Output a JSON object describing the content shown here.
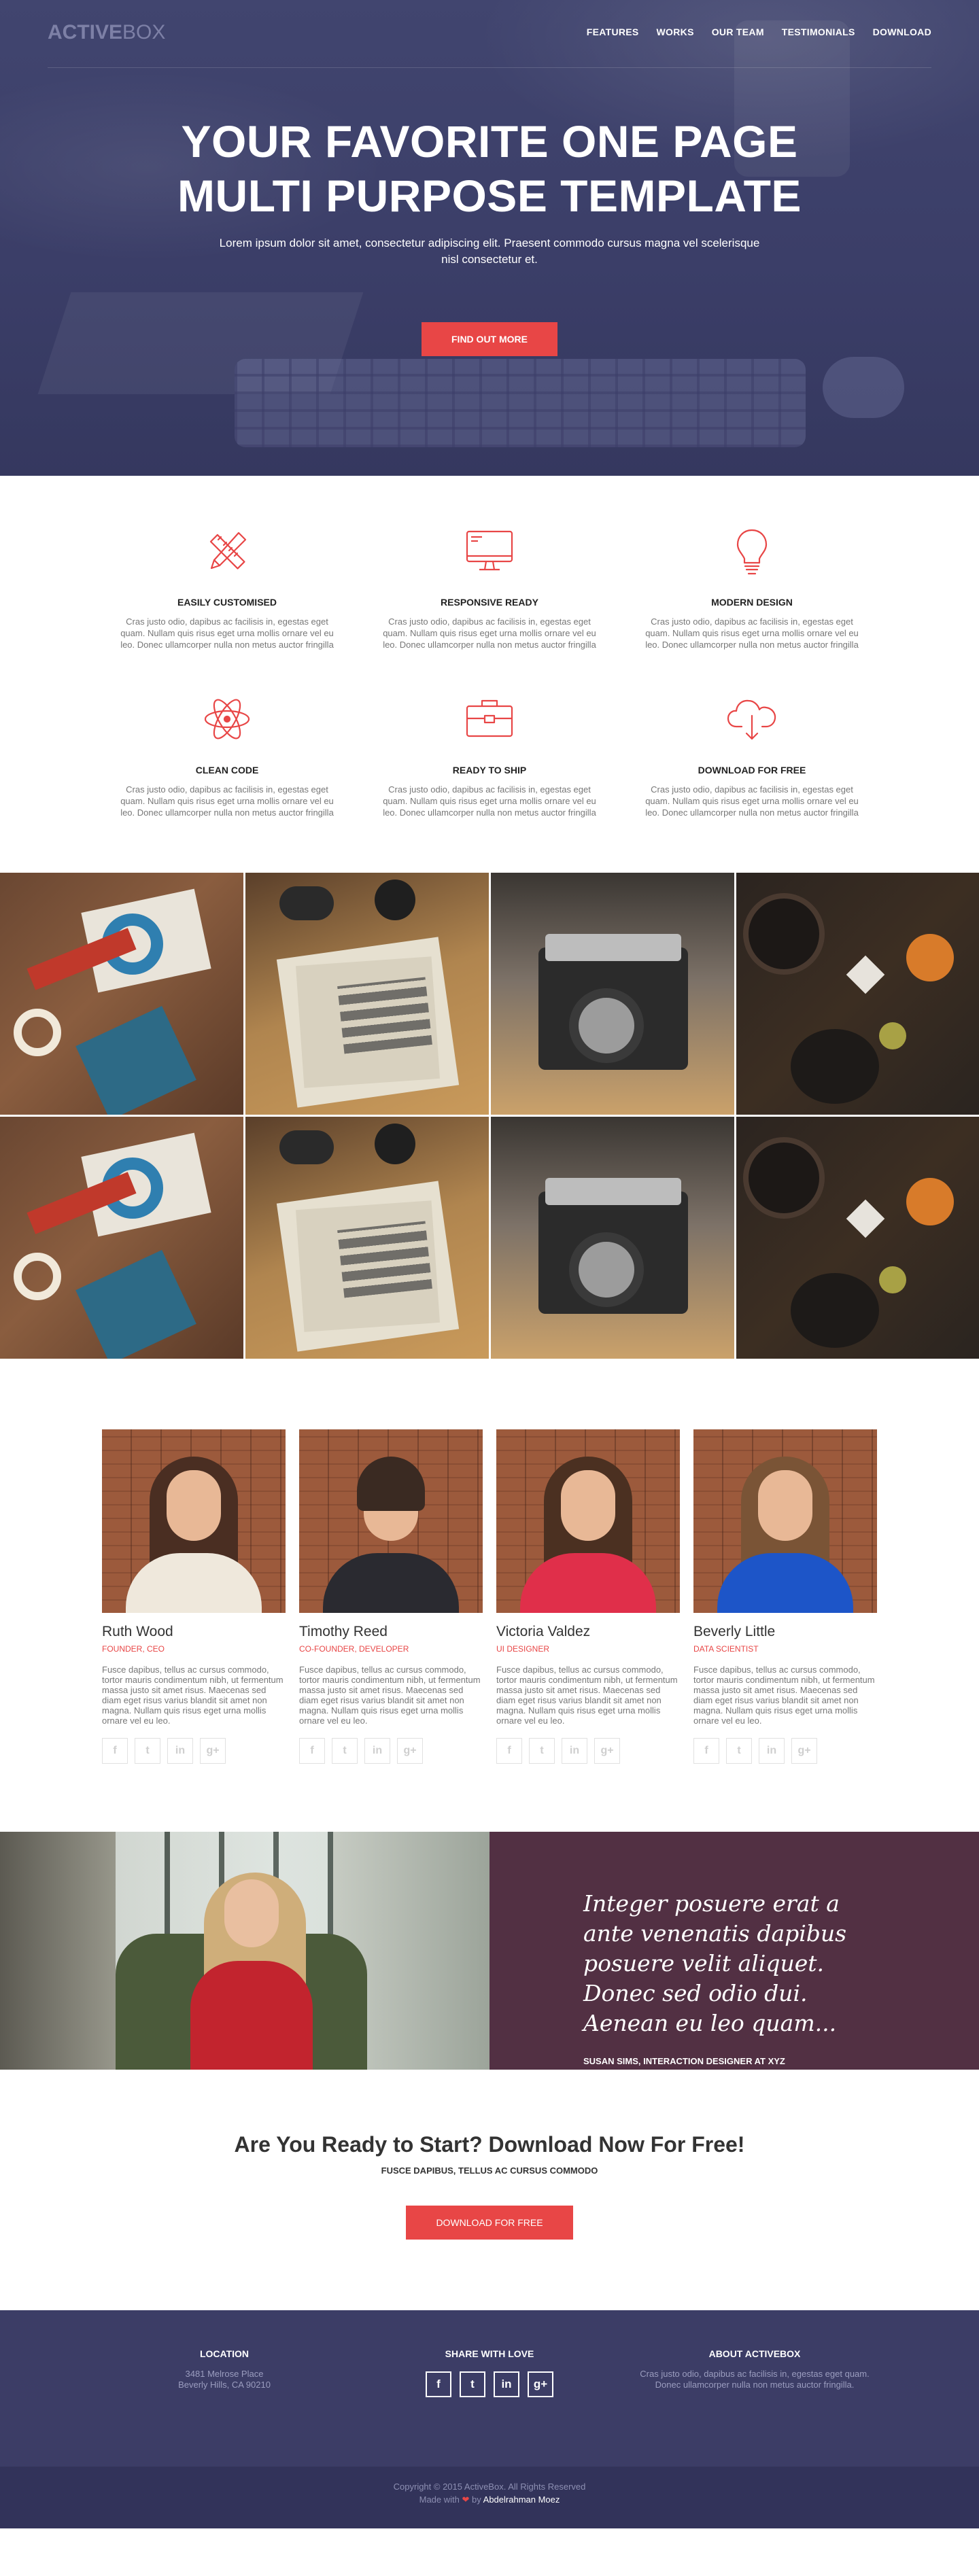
{
  "brand": {
    "part1": "ACTIVE",
    "part2": "BOX"
  },
  "nav": {
    "items": [
      "FEATURES",
      "WORKS",
      "OUR TEAM",
      "TESTIMONIALS",
      "DOWNLOAD"
    ]
  },
  "hero": {
    "title_line1": "YOUR FAVORITE ONE PAGE",
    "title_line2": "MULTI PURPOSE TEMPLATE",
    "subtitle": "Lorem ipsum dolor sit amet, consectetur adipiscing elit. Praesent commodo cursus magna vel scelerisque nisl consectetur et.",
    "button": "FIND OUT MORE"
  },
  "features": [
    {
      "icon": "pencil-ruler-icon",
      "title": "EASILY CUSTOMISED",
      "text": "Cras justo odio, dapibus ac facilisis in, egestas eget quam. Nullam quis risus eget urna mollis ornare vel eu leo. Donec ullamcorper nulla non metus auctor fringilla"
    },
    {
      "icon": "monitor-icon",
      "title": "RESPONSIVE READY",
      "text": "Cras justo odio, dapibus ac facilisis in, egestas eget quam. Nullam quis risus eget urna mollis ornare vel eu leo. Donec ullamcorper nulla non metus auctor fringilla"
    },
    {
      "icon": "lightbulb-icon",
      "title": "MODERN DESIGN",
      "text": "Cras justo odio, dapibus ac facilisis in, egestas eget quam. Nullam quis risus eget urna mollis ornare vel eu leo. Donec ullamcorper nulla non metus auctor fringilla"
    },
    {
      "icon": "atom-icon",
      "title": "CLEAN CODE",
      "text": "Cras justo odio, dapibus ac facilisis in, egestas eget quam. Nullam quis risus eget urna mollis ornare vel eu leo. Donec ullamcorper nulla non metus auctor fringilla"
    },
    {
      "icon": "briefcase-icon",
      "title": "READY TO SHIP",
      "text": "Cras justo odio, dapibus ac facilisis in, egestas eget quam. Nullam quis risus eget urna mollis ornare vel eu leo. Donec ullamcorper nulla non metus auctor fringilla"
    },
    {
      "icon": "cloud-download-icon",
      "title": "DOWNLOAD FOR FREE",
      "text": "Cras justo odio, dapibus ac facilisis in, egestas eget quam. Nullam quis risus eget urna mollis ornare vel eu leo. Donec ullamcorper nulla non metus auctor fringilla"
    }
  ],
  "team": [
    {
      "name": "Ruth Wood",
      "role": "FOUNDER, CEO",
      "bio": "Fusce dapibus, tellus ac cursus commodo, tortor mauris condimentum nibh, ut fermentum massa justo sit amet risus. Maecenas sed diam eget risus varius blandit sit amet non magna. Nullam quis risus eget urna mollis ornare vel eu leo."
    },
    {
      "name": "Timothy Reed",
      "role": "CO-FOUNDER, DEVELOPER",
      "bio": "Fusce dapibus, tellus ac cursus commodo, tortor mauris condimentum nibh, ut fermentum massa justo sit amet risus. Maecenas sed diam eget risus varius blandit sit amet non magna. Nullam quis risus eget urna mollis ornare vel eu leo."
    },
    {
      "name": "Victoria Valdez",
      "role": "UI DESIGNER",
      "bio": "Fusce dapibus, tellus ac cursus commodo, tortor mauris condimentum nibh, ut fermentum massa justo sit amet risus. Maecenas sed diam eget risus varius blandit sit amet non magna. Nullam quis risus eget urna mollis ornare vel eu leo."
    },
    {
      "name": "Beverly Little",
      "role": "DATA SCIENTIST",
      "bio": "Fusce dapibus, tellus ac cursus commodo, tortor mauris condimentum nibh, ut fermentum massa justo sit amet risus. Maecenas sed diam eget risus varius blandit sit amet non magna. Nullam quis risus eget urna mollis ornare vel eu leo."
    }
  ],
  "social_glyphs": {
    "facebook": "f",
    "twitter": "t",
    "linkedin": "in",
    "google": "g+"
  },
  "testimonial": {
    "quote": "Integer posuere erat a ante venenatis dapibus posuere velit aliquet. Donec sed odio dui. Aenean eu leo quam...",
    "author": "SUSAN SIMS, INTERACTION DESIGNER AT XYZ"
  },
  "cta": {
    "title": "Are You Ready to Start? Download Now For Free!",
    "subtitle": "FUSCE DAPIBUS, TELLUS AC CURSUS COMMODO",
    "button": "DOWNLOAD FOR FREE"
  },
  "footer": {
    "location_title": "LOCATION",
    "address_line1": "3481 Melrose Place",
    "address_line2": "Beverly Hills, CA 90210",
    "share_title": "SHARE WITH LOVE",
    "about_title": "ABOUT ACTIVEBOX",
    "about_text": "Cras justo odio, dapibus ac facilisis in, egestas eget quam. Donec ullamcorper nulla non metus auctor fringilla."
  },
  "bottom": {
    "copyright": "Copyright © 2015 ActiveBox. All Rights Reserved",
    "made_with": "Made with",
    "by": "by",
    "author": "Abdelrahman Moez"
  },
  "colors": {
    "accent": "#e84646",
    "hero_bg": "#3c3f6a",
    "testimonial_bg": "#523043",
    "footer_bg": "#3c3d66"
  }
}
